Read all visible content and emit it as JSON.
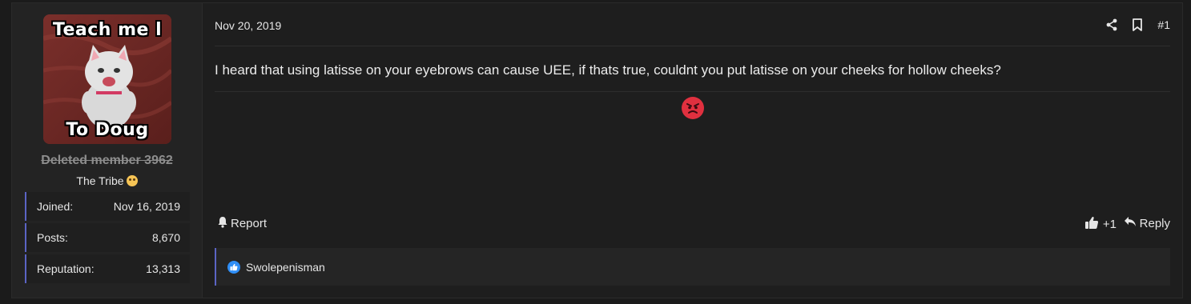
{
  "user": {
    "avatar_text_top": "Teach me l",
    "avatar_text_bottom": "To Doug",
    "username": "Deleted member 3962",
    "title": "The Tribe",
    "stats": [
      {
        "label": "Joined:",
        "value": "Nov 16, 2019"
      },
      {
        "label": "Posts:",
        "value": "8,670"
      },
      {
        "label": "Reputation:",
        "value": "13,313"
      }
    ]
  },
  "post": {
    "date": "Nov 20, 2019",
    "number": "#1",
    "message": "I heard that using latisse on your eyebrows can cause UEE, if thats true, couldnt you put latisse on your cheeks for hollow cheeks?",
    "report_label": "Report",
    "like_count": "+1",
    "reply_label": "Reply",
    "reactions_user": "Swolepenisman"
  },
  "colors": {
    "accent": "#5b64c4",
    "like_blue": "#2f8ef6",
    "angry_red": "#e0303f"
  },
  "icons": [
    "share-icon",
    "bookmark-icon",
    "angry-face-emoji",
    "bell-icon",
    "thumbs-up-icon",
    "reply-icon",
    "like-reaction-icon"
  ]
}
